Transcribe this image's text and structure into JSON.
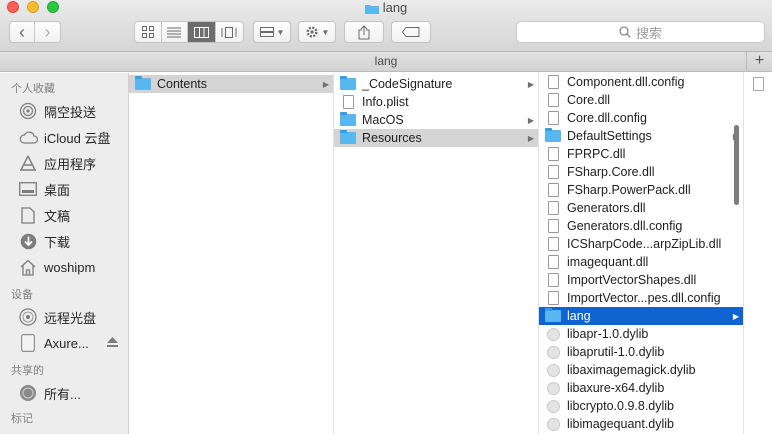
{
  "window": {
    "title": "lang",
    "path_title": "lang",
    "plus_label": "+"
  },
  "toolbar": {
    "back": "‹",
    "forward": "›",
    "search_placeholder": "搜索"
  },
  "sidebar": {
    "favorites_heading": "个人收藏",
    "favorites": [
      {
        "label": "隔空投送",
        "icon": "airdrop-icon"
      },
      {
        "label": "iCloud 云盘",
        "icon": "cloud-icon"
      },
      {
        "label": "应用程序",
        "icon": "applications-icon"
      },
      {
        "label": "桌面",
        "icon": "desktop-icon"
      },
      {
        "label": "文稿",
        "icon": "documents-icon"
      },
      {
        "label": "下载",
        "icon": "download-icon"
      },
      {
        "label": "woshipm",
        "icon": "home-icon"
      }
    ],
    "devices_heading": "设备",
    "devices": [
      {
        "label": "远程光盘",
        "icon": "disc-icon"
      },
      {
        "label": "Axure...",
        "icon": "drive-icon"
      }
    ],
    "shared_heading": "共享的",
    "shared": [
      {
        "label": "所有...",
        "icon": "network-icon"
      }
    ],
    "tags_heading": "标记"
  },
  "columns": {
    "col1": [
      {
        "name": "Contents",
        "type": "folder",
        "state": "selected-grey",
        "has_children": true
      }
    ],
    "col2": [
      {
        "name": "_CodeSignature",
        "type": "folder",
        "has_children": true
      },
      {
        "name": "Info.plist",
        "type": "doc",
        "has_children": false
      },
      {
        "name": "MacOS",
        "type": "folder",
        "has_children": true
      },
      {
        "name": "Resources",
        "type": "folder",
        "state": "selected-grey",
        "has_children": true
      }
    ],
    "col3": [
      {
        "name": "Component.dll.config",
        "type": "doc",
        "has_children": false
      },
      {
        "name": "Core.dll",
        "type": "doc",
        "has_children": false
      },
      {
        "name": "Core.dll.config",
        "type": "doc",
        "has_children": false
      },
      {
        "name": "DefaultSettings",
        "type": "folder",
        "has_children": true
      },
      {
        "name": "FPRPC.dll",
        "type": "doc",
        "has_children": false
      },
      {
        "name": "FSharp.Core.dll",
        "type": "doc",
        "has_children": false
      },
      {
        "name": "FSharp.PowerPack.dll",
        "type": "doc",
        "has_children": false
      },
      {
        "name": "Generators.dll",
        "type": "doc",
        "has_children": false
      },
      {
        "name": "Generators.dll.config",
        "type": "doc",
        "has_children": false
      },
      {
        "name": "ICSharpCode...arpZipLib.dll",
        "type": "doc",
        "has_children": false
      },
      {
        "name": "imagequant.dll",
        "type": "doc",
        "has_children": false
      },
      {
        "name": "ImportVectorShapes.dll",
        "type": "doc",
        "has_children": false
      },
      {
        "name": "ImportVector...pes.dll.config",
        "type": "doc",
        "has_children": false
      },
      {
        "name": "lang",
        "type": "folder",
        "state": "selected-blue",
        "has_children": true
      },
      {
        "name": "libapr-1.0.dylib",
        "type": "dylib",
        "has_children": false
      },
      {
        "name": "libaprutil-1.0.dylib",
        "type": "dylib",
        "has_children": false
      },
      {
        "name": "libaximagemagick.dylib",
        "type": "dylib",
        "has_children": false
      },
      {
        "name": "libaxure-x64.dylib",
        "type": "dylib",
        "has_children": false
      },
      {
        "name": "libcrypto.0.9.8.dylib",
        "type": "dylib",
        "has_children": false
      },
      {
        "name": "libimagequant.dylib",
        "type": "dylib",
        "has_children": false
      }
    ]
  },
  "colors": {
    "selection_blue": "#0f64d2",
    "selection_grey": "#d4d4d4",
    "folder": "#58b7ef"
  }
}
